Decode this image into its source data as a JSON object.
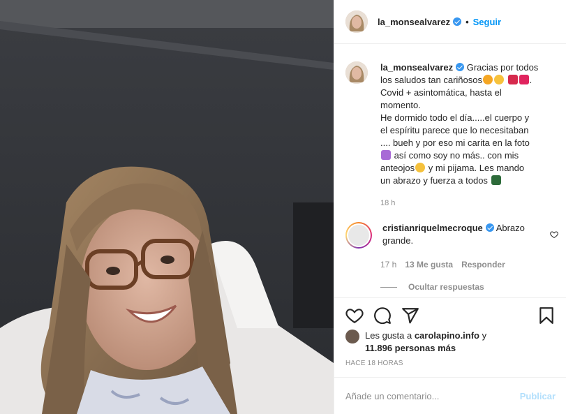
{
  "post": {
    "username": "la_monsealvarez",
    "follow_label": "Seguir",
    "caption_lines": [
      "Gracias por todos",
      "los saludos tan cariñosos",
      "Covid + asintomática, hasta el",
      "momento.",
      "He dormido todo el día.....el cuerpo y",
      "el espíritu parece que lo necesitaban",
      ".... bueh y por eso mi carita en la foto",
      " así como soy no más.. con mis",
      "anteojos",
      " y mi pijama. Les mando",
      "un abrazo y fuerza a todos"
    ],
    "caption_time": "18 h"
  },
  "comment": {
    "username": "cristianriquelmecroque",
    "text_first": "Abrazo",
    "text_second": "grande.",
    "time": "17 h",
    "likes": "13 Me gusta",
    "reply_label": "Responder",
    "hide_replies_label": "Ocultar respuestas"
  },
  "likes_line": {
    "prefix": "Les gusta a ",
    "user": "carolapino.info",
    "connector": " y",
    "count": "11.896 personas más"
  },
  "posted_ago": "HACE 18 HORAS",
  "composer": {
    "placeholder": "Añade un comentario...",
    "publish_label": "Publicar"
  },
  "icons": [
    "heart-icon",
    "comment-icon",
    "share-icon",
    "bookmark-icon",
    "verified-icon"
  ],
  "colors": {
    "accent": "#0095f6",
    "publish_disabled": "#b2dffc",
    "meta": "#8e8e8e"
  }
}
